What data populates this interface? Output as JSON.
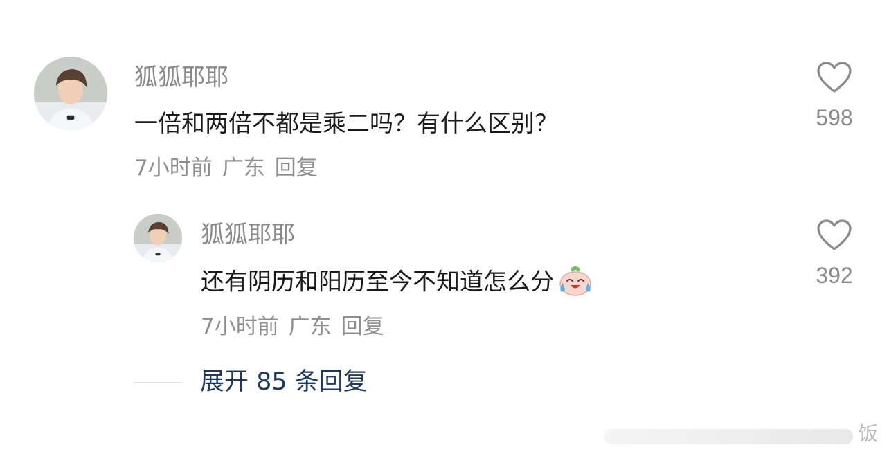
{
  "comment": {
    "username": "狐狐耶耶",
    "text": "一倍和两倍不都是乘二吗？有什么区别？",
    "time": "7小时前",
    "location": "广东",
    "reply_label": "回复",
    "likes": "598"
  },
  "reply": {
    "username": "狐狐耶耶",
    "text": "还有阴历和阳历至今不知道怎么分",
    "emoji": "crying-laughing-emoji",
    "time": "7小时前",
    "location": "广东",
    "reply_label": "回复",
    "likes": "392"
  },
  "expand": {
    "label": "展开 85 条回复"
  },
  "watermark": {
    "text": "饭"
  },
  "colors": {
    "username": "#8a8a8a",
    "content": "#1a1a1a",
    "meta": "#8f8f8f",
    "expand": "#1f3a5f",
    "heart": "#8a8a8a"
  }
}
